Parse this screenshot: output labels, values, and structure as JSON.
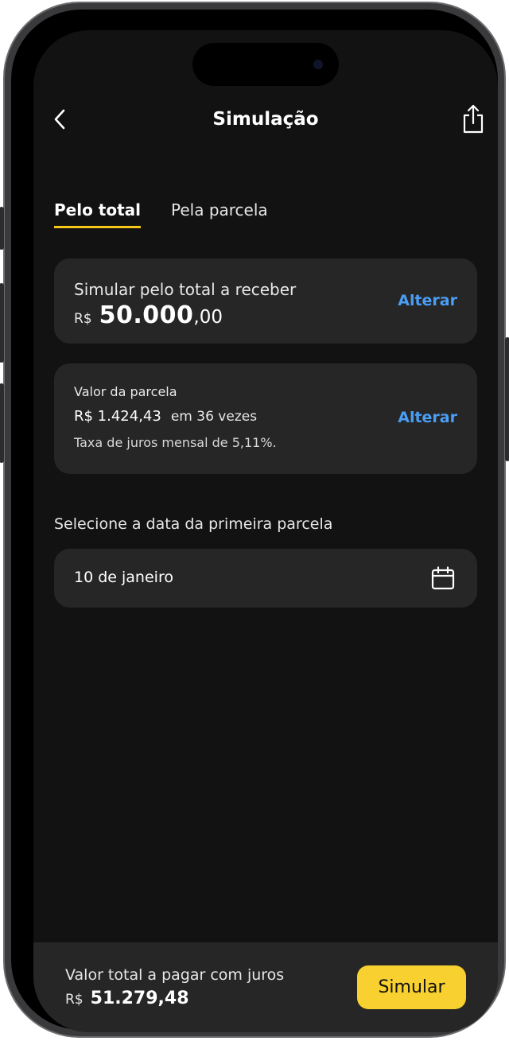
{
  "header": {
    "title": "Simulação",
    "back_icon": "chevron-left-icon",
    "share_icon": "share-icon"
  },
  "tabs": [
    {
      "label": "Pelo total",
      "active": true
    },
    {
      "label": "Pela parcela",
      "active": false
    }
  ],
  "total_card": {
    "label": "Simular pelo total a receber",
    "currency": "R$",
    "amount_int": "50.000",
    "amount_dec": ",00",
    "action": "Alterar"
  },
  "installment_card": {
    "label": "Valor da parcela",
    "amount": "R$ 1.424,43",
    "times": "em 36 vezes",
    "rate": "Taxa de juros mensal de 5,11%.",
    "action": "Alterar"
  },
  "first_installment": {
    "heading": "Selecione a data da primeira parcela",
    "date": "10 de janeiro",
    "icon": "calendar-icon"
  },
  "footer": {
    "label": "Valor total a pagar com juros",
    "currency": "R$",
    "amount": "51.279,48",
    "button": "Simular"
  },
  "colors": {
    "background": "#121212",
    "card": "#262626",
    "accent_yellow": "#f8d02f",
    "link_blue": "#4a9ef5"
  }
}
